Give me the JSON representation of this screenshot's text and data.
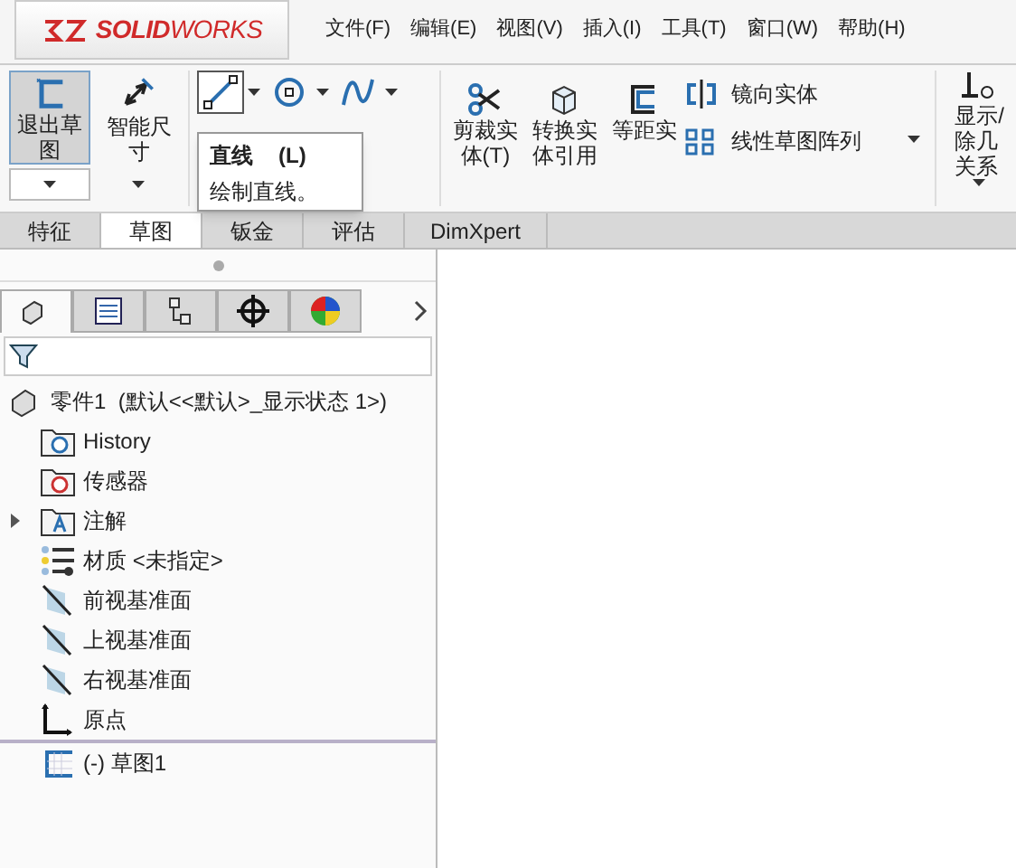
{
  "logo": {
    "name": "**SOLID**WORKS"
  },
  "menu": [
    "文件(F)",
    "编辑(E)",
    "视图(V)",
    "插入(I)",
    "工具(T)",
    "窗口(W)",
    "帮助(H)"
  ],
  "ribbon": {
    "big_buttons": [
      {
        "label": "退出草图",
        "selected": true,
        "kind": "exit"
      },
      {
        "label": "智能尺寸",
        "selected": false,
        "kind": "dim"
      }
    ],
    "tools": [
      {
        "kind": "line",
        "selected": true
      },
      {
        "kind": "circle",
        "selected": false
      },
      {
        "kind": "spline",
        "selected": false
      }
    ],
    "text_tools": [
      {
        "label": "剪裁实体(T)",
        "kind": "trim"
      },
      {
        "label": "转换实体引用",
        "kind": "convert"
      },
      {
        "label": "等距实",
        "kind": "offset"
      }
    ],
    "small_tools": [
      {
        "label": "镜向实体",
        "kind": "mirror"
      },
      {
        "label": "线性草图阵列",
        "kind": "pattern"
      }
    ],
    "cut_tool": {
      "lines": [
        "显示/",
        "除几",
        "关系"
      ]
    }
  },
  "tabs": [
    {
      "label": "特征",
      "selected": false
    },
    {
      "label": "草图",
      "selected": true
    },
    {
      "label": "钣金",
      "selected": false
    },
    {
      "label": "评估",
      "selected": false
    },
    {
      "label": "DimXpert",
      "selected": false
    }
  ],
  "tooltip": {
    "title": "直线",
    "key": "(L)",
    "description": "绘制直线。"
  },
  "panel_tabs": [
    {
      "kind": "tree",
      "selected": true
    },
    {
      "kind": "property",
      "selected": false
    },
    {
      "kind": "config",
      "selected": false
    },
    {
      "kind": "dimxpert",
      "selected": false
    },
    {
      "kind": "display",
      "selected": false
    }
  ],
  "tree": {
    "label": "零件1  (默认<<默认>_显示状态 1>)",
    "children": [
      {
        "label": "History",
        "kind": "history"
      },
      {
        "label": "传感器",
        "kind": "sensor"
      },
      {
        "label": "注解",
        "kind": "annotation",
        "expanded": false
      },
      {
        "label": "材质 <未指定>",
        "kind": "material"
      },
      {
        "label": "前视基准面",
        "kind": "plane"
      },
      {
        "label": "上视基准面",
        "kind": "plane"
      },
      {
        "label": "右视基准面",
        "kind": "plane"
      },
      {
        "label": "原点",
        "kind": "origin"
      },
      {
        "label": "(-) 草图1",
        "kind": "sketch",
        "rolled_back": true
      }
    ]
  }
}
